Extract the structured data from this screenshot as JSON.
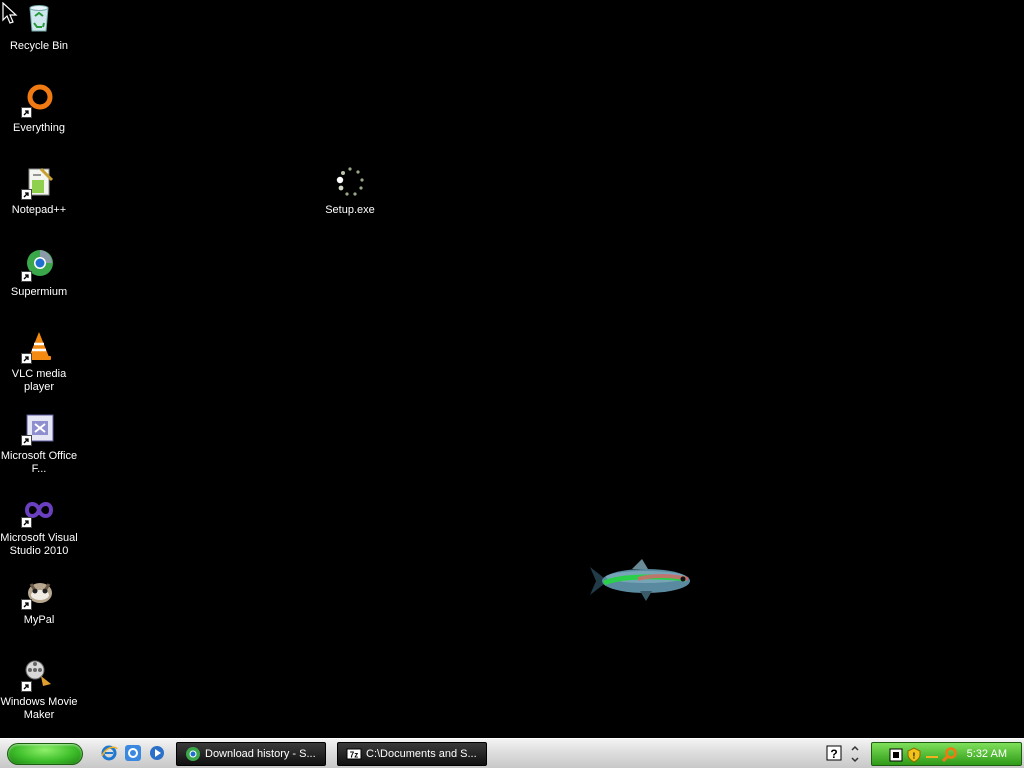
{
  "desktop": {
    "icons": [
      {
        "label": "Recycle Bin",
        "icon": "recycle-bin-icon"
      },
      {
        "label": "Everything",
        "icon": "everything-icon"
      },
      {
        "label": "Notepad++",
        "icon": "notepad-plus-plus-icon"
      },
      {
        "label": "Supermium",
        "icon": "supermium-icon"
      },
      {
        "label": "VLC media player",
        "icon": "vlc-icon"
      },
      {
        "label": "Microsoft Office F...",
        "icon": "office-icon"
      },
      {
        "label": "Microsoft Visual Studio 2010",
        "icon": "visual-studio-icon"
      },
      {
        "label": "MyPal",
        "icon": "mypal-icon"
      },
      {
        "label": "Windows Movie Maker",
        "icon": "movie-maker-icon"
      },
      {
        "label": "Setup.exe",
        "icon": "setup-loading-icon"
      }
    ]
  },
  "taskbar": {
    "tasks": [
      {
        "label": "Download history - S...",
        "icon": "supermium-icon"
      },
      {
        "label": "C:\\Documents and S...",
        "icon": "7zip-icon"
      }
    ],
    "clock": "5:32 AM"
  },
  "colors": {
    "desktop_bg": "#000000",
    "start_green": "#3fbf2b",
    "tray_green": "#2e9a17",
    "task_bg": "#1a1a1a"
  }
}
